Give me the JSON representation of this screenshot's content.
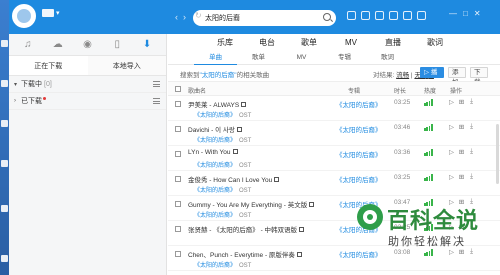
{
  "header": {
    "search_value": "太阳的后裔",
    "window_controls": [
      "—",
      "□",
      "✕"
    ]
  },
  "sidebar": {
    "tab_icons": [
      "music-note-icon",
      "cloud-icon",
      "broadcast-icon",
      "phone-icon",
      "download-icon"
    ],
    "sub_tabs": [
      "正在下载",
      "本地导入"
    ],
    "sections": [
      {
        "label": "下载中",
        "count": "[0]"
      },
      {
        "label": "已下载",
        "count": ""
      }
    ]
  },
  "main": {
    "top_tabs": [
      "乐库",
      "电台",
      "歌单",
      "MV",
      "直播",
      "歌词"
    ],
    "sub_tabs": [
      "单曲",
      "歌单",
      "MV",
      "专辑",
      "歌词"
    ],
    "search_info": {
      "prefix": "搜索到",
      "keyword": "\"太阳的后裔\"",
      "suffix": "的相关歌曲"
    },
    "quality": {
      "label": "对结果:",
      "option1": "流畅",
      "option2": "无损度"
    },
    "buttons": {
      "play": "播放",
      "add": "添加",
      "download": "下载"
    },
    "table_header": {
      "name": "歌曲名",
      "album": "专辑",
      "duration": "时长",
      "heat": "热度",
      "ops": "操作"
    },
    "songs": [
      {
        "title": "尹美莱 - ALWAYS",
        "album": "《太阳的后裔》",
        "ost": "OST",
        "album_col": "《太阳的后裔》",
        "duration": "03:25"
      },
      {
        "title": "Davichi - 이 사랑",
        "album": "《太阳的后裔》",
        "ost": "OST",
        "album_col": "《太阳的后裔》",
        "duration": "03:46"
      },
      {
        "title": "LYn - With You",
        "album": "《太阳的后裔》",
        "ost": "OST",
        "album_col": "《太阳的后裔》",
        "duration": "03:36"
      },
      {
        "title": "金俊秀 - How Can I Love You",
        "album": "《太阳的后裔》",
        "ost": "OST",
        "album_col": "《太阳的后裔》",
        "duration": "03:25"
      },
      {
        "title": "Gummy - You Are My Everything - 英文版",
        "album": "《太阳的后裔》",
        "ost": "OST",
        "album_col": "《太阳的后裔》",
        "duration": "03:47"
      },
      {
        "title": "张贤赫 - 《太阳的后裔》 - 中韩双语版",
        "album": "",
        "ost": "",
        "album_col": "《太阳的后裔》",
        "duration": "03:25"
      },
      {
        "title": "Chen、Punch - Everytime - 原版伴奏",
        "album": "《太阳的后裔》",
        "ost": "OST",
        "album_col": "《太阳的后裔》",
        "duration": "03:08"
      }
    ]
  },
  "watermark": {
    "title": "百科全说",
    "subtitle": "助你轻松解决"
  },
  "colors": {
    "accent": "#1e8ae0",
    "heat": "#39b54a",
    "watermark_green": "#2e8b3d"
  }
}
